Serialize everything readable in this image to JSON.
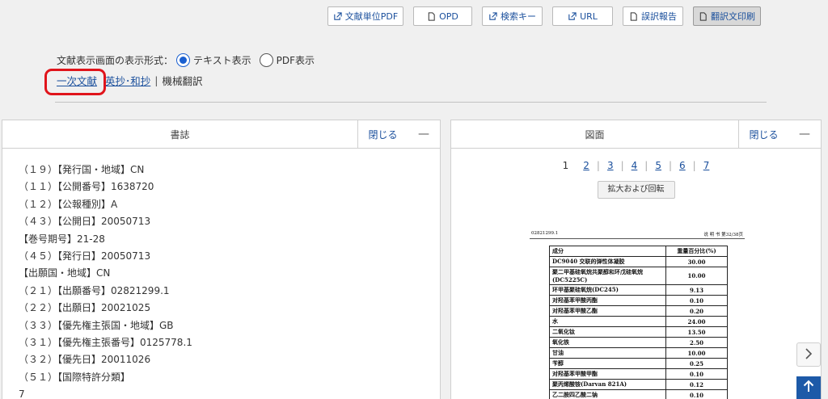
{
  "toolbar": {
    "buttons": [
      {
        "label": "文献単位PDF",
        "icon": "external-link-icon"
      },
      {
        "label": "OPD",
        "icon": "document-icon"
      },
      {
        "label": "検索キー",
        "icon": "external-link-icon"
      },
      {
        "label": "URL",
        "icon": "external-link-icon"
      },
      {
        "label": "誤訳報告",
        "icon": "document-icon"
      },
      {
        "label": "翻訳文印刷",
        "icon": "document-icon"
      }
    ]
  },
  "display_mode": {
    "label": "文献表示画面の表示形式：",
    "options": [
      "テキスト表示",
      "PDF表示"
    ],
    "selected": "テキスト表示"
  },
  "doc_links": {
    "primary": "一次文献",
    "english": "英抄･和抄",
    "separator": "|",
    "machine": "機械翻訳"
  },
  "biblio_panel": {
    "title": "書誌",
    "close": "閉じる",
    "minimize": "—",
    "lines": [
      "（１９）【発行国・地域】CN",
      "（１１）【公開番号】1638720",
      "（１２）【公報種別】A",
      "（４３）【公開日】20050713",
      "【巻号期号】21-28",
      "（４５）【発行日】20050713",
      "【出願国・地域】CN",
      "（２１）【出願番号】02821299.1",
      "（２２）【出願日】20021025",
      "（３３）【優先権主張国・地域】GB",
      "（３１）【優先権主張番号】0125778.1",
      "（３２）【優先日】20011026",
      "（５１）【国際特許分類】",
      "7"
    ]
  },
  "figure_panel": {
    "title": "図面",
    "close": "閉じる",
    "minimize": "—",
    "pages": [
      "1",
      "2",
      "3",
      "4",
      "5",
      "6",
      "7"
    ],
    "current_page": "1",
    "zoom_button": "拡大および回転",
    "doc_header_left": "02821299.1",
    "doc_header_right": "说 明 书 第32/38页",
    "table": [
      [
        "成分",
        "重量百分比(%)"
      ],
      [
        "DC9040 交联的弹性体凝胶",
        "30.00"
      ],
      [
        "聚二甲基硅氧烷共聚醇和环戊硅氧烷 (DC5225C)",
        "10.00"
      ],
      [
        "环甲基聚硅氧烷(DC245)",
        "9.13"
      ],
      [
        "对羟基苯甲酸丙酯",
        "0.10"
      ],
      [
        "对羟基苯甲酸乙酯",
        "0.20"
      ],
      [
        "水",
        "24.00"
      ],
      [
        "二氧化钛",
        "13.50"
      ],
      [
        "氧化铁",
        "2.50"
      ],
      [
        "甘油",
        "10.00"
      ],
      [
        "苄醇",
        "0.25"
      ],
      [
        "对羟基苯甲酸甲酯",
        "0.10"
      ],
      [
        "聚丙烯酸铵(Darvan 821A)",
        "0.12"
      ],
      [
        "乙二胺四乙酸二钠",
        "0.10"
      ]
    ]
  }
}
